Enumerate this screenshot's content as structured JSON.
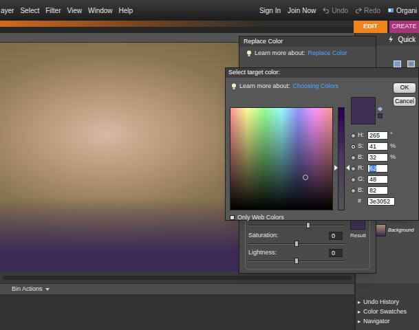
{
  "menu": {
    "items": [
      "ayer",
      "Select",
      "Filter",
      "View",
      "Window",
      "Help"
    ]
  },
  "account_links": [
    "Sign In",
    "Join Now"
  ],
  "history_buttons": [
    {
      "label": "Undo",
      "disabled": true
    },
    {
      "label": "Redo",
      "disabled": true
    }
  ],
  "organizer": {
    "label": "Organi"
  },
  "mode_tabs": [
    {
      "label": "EDIT",
      "selected": true,
      "color": "#f0841c"
    },
    {
      "label": "CREATE",
      "selected": false,
      "color": "#a8357a"
    }
  ],
  "panel": {
    "tab": "Quick",
    "layers": [
      {
        "name": "Background"
      }
    ]
  },
  "bin": {
    "title": "Bin Actions"
  },
  "collapsed_panels": [
    {
      "label": "Undo History",
      "glyph": "▸",
      "expanded": false
    },
    {
      "label": "Color Swatches",
      "glyph": "▸",
      "expanded": false
    },
    {
      "label": "Navigator",
      "glyph": "▸",
      "expanded": false
    }
  ],
  "replace_color": {
    "title": "Replace Color",
    "learn_label": "Learn more about:",
    "learn_link": "Replace Color",
    "hue_level": 0.62,
    "adjustments": [
      {
        "label": "Saturation:",
        "value": "0",
        "level": 0.5
      },
      {
        "label": "Lightness:",
        "value": "0",
        "level": 0.5
      }
    ],
    "result_label": "Result"
  },
  "color_picker": {
    "title": "Select target color:",
    "learn_label": "Learn more about:",
    "learn_link": "Choosing Colors",
    "buttons": [
      "OK",
      "Cancel"
    ],
    "fields": [
      {
        "label": "H:",
        "value": "265",
        "unit": "°",
        "selected": false,
        "highlighted": false
      },
      {
        "label": "S:",
        "value": "41",
        "unit": "%",
        "selected": true,
        "highlighted": false
      },
      {
        "label": "B:",
        "value": "32",
        "unit": "%",
        "selected": false,
        "highlighted": false
      },
      {
        "label": "R:",
        "value": "62",
        "unit": "",
        "selected": false,
        "highlighted": true
      },
      {
        "label": "G:",
        "value": "48",
        "unit": "",
        "selected": false,
        "highlighted": false
      },
      {
        "label": "B:",
        "value": "82",
        "unit": "",
        "selected": false,
        "highlighted": false
      }
    ],
    "hex": {
      "label": "#",
      "value": "3e3052"
    },
    "web_only": {
      "label": "Only Web Colors",
      "checked": false
    }
  }
}
